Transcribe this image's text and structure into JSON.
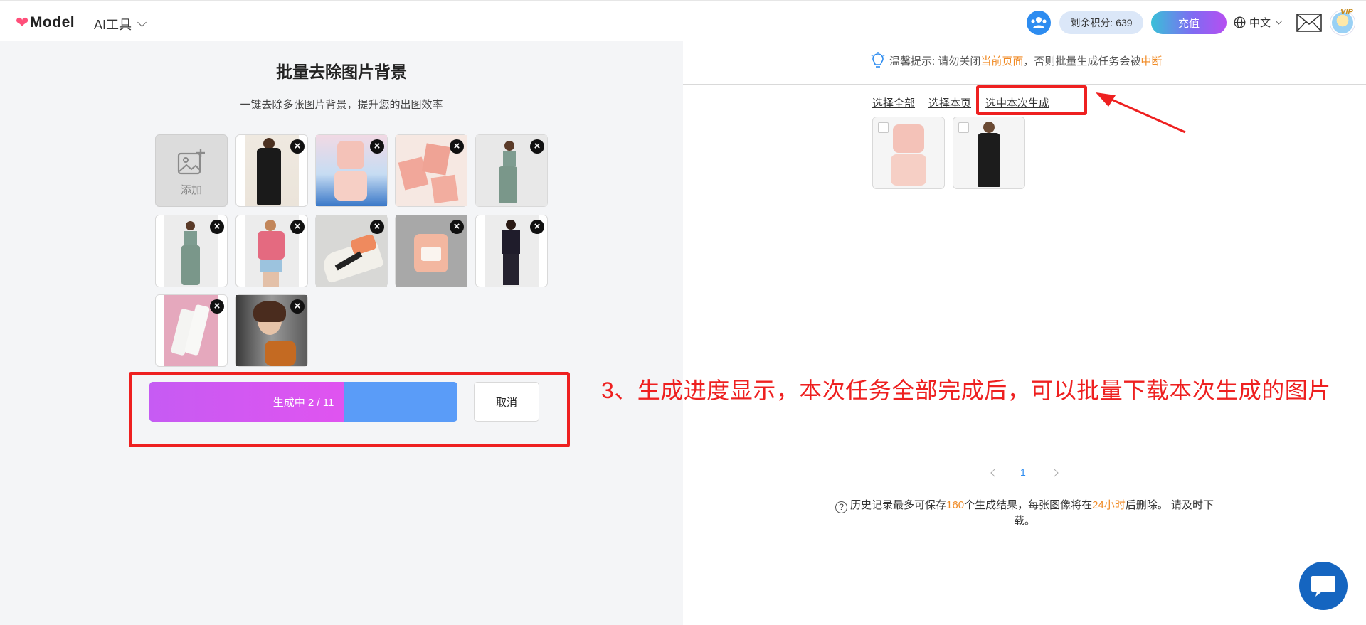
{
  "header": {
    "logo_text": "Model",
    "ai_tools_label": "AI工具",
    "points_label": "剩余积分: 639",
    "recharge_label": "充值",
    "language_label": "中文",
    "vip_label": "VIP"
  },
  "left": {
    "title": "批量去除图片背景",
    "subtitle": "一键去除多张图片背景，提升您的出图效率",
    "add_label": "添加",
    "progress_label": "生成中 2 / 11",
    "progress_done": 2,
    "progress_total": 11,
    "cancel_label": "取消",
    "thumbnails": [
      {
        "icon": "woman-black-coat-photo"
      },
      {
        "icon": "pink-cosmetic-jar-photo"
      },
      {
        "icon": "pink-boxes-photo"
      },
      {
        "icon": "woman-sportswear-photo"
      },
      {
        "icon": "woman-green-leggings-photo"
      },
      {
        "icon": "woman-pink-shirt-photo"
      },
      {
        "icon": "sneaker-photo"
      },
      {
        "icon": "candle-photo"
      },
      {
        "icon": "woman-vest-photo"
      },
      {
        "icon": "white-bottles-photo"
      },
      {
        "icon": "woman-portrait-photo"
      }
    ]
  },
  "right": {
    "tip_prefix": "温馨提示: 请勿关闭",
    "tip_highlight1": "当前页面",
    "tip_middle": "，否则批量生成任务会被",
    "tip_highlight2": "中断",
    "select_all": "选择全部",
    "select_page": "选择本页",
    "select_current": "选中本次生成",
    "page_number": "1",
    "history_prefix": "历史记录最多可保存",
    "history_count": "160",
    "history_middle": "个生成结果，每张图像将在",
    "history_hours": "24小时",
    "history_suffix": "后删除。 请及时下载。"
  },
  "annotation": {
    "text": "3、生成进度显示，本次任务全部完成后，可以批量下载本次生成的图片",
    "color": "#ee2020"
  },
  "colors": {
    "accent_blue": "#2d8cf0",
    "highlight_orange": "#f08a24",
    "progress_fill": "#d057f2",
    "progress_track": "#5a9cf8"
  }
}
